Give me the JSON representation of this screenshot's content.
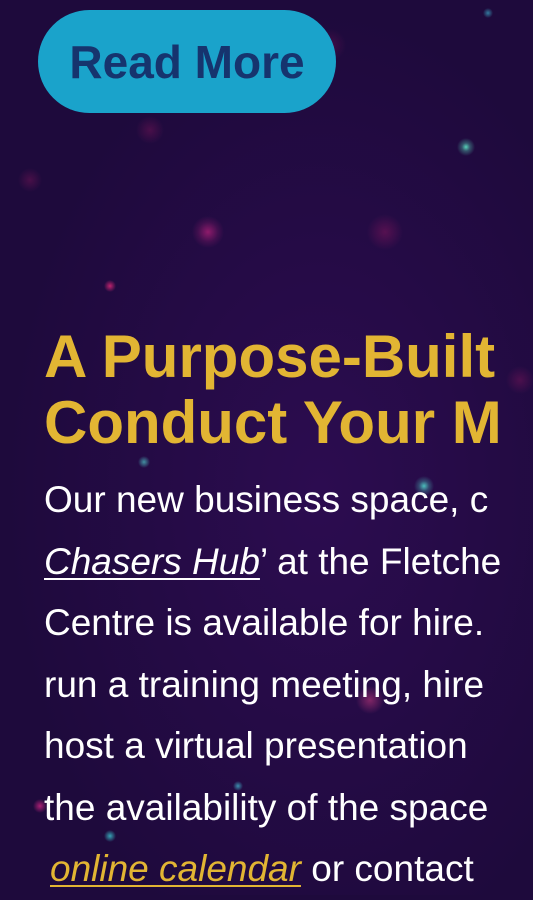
{
  "cta": {
    "read_more_label": "Read More"
  },
  "section": {
    "heading_line1": "A Purpose-Built",
    "heading_line2": "Conduct Your M",
    "body": {
      "line1": "Our new business space, c",
      "hub_link_text": "Chasers Hub",
      "line2_rest": "’ at the Fletche",
      "line3": "Centre is available for hire.",
      "line4": "run a training meeting, hire",
      "line5": "host a virtual presentation",
      "line6": "the availability of the space",
      "calendar_link_text": "online calendar",
      "line7_rest": " or contact"
    }
  },
  "colors": {
    "background": "#1e0a3c",
    "button_bg": "#1aa3cb",
    "button_text": "#16346e",
    "heading": "#e2b533",
    "body_text": "#ffffff",
    "link_accent": "#e2b533"
  }
}
